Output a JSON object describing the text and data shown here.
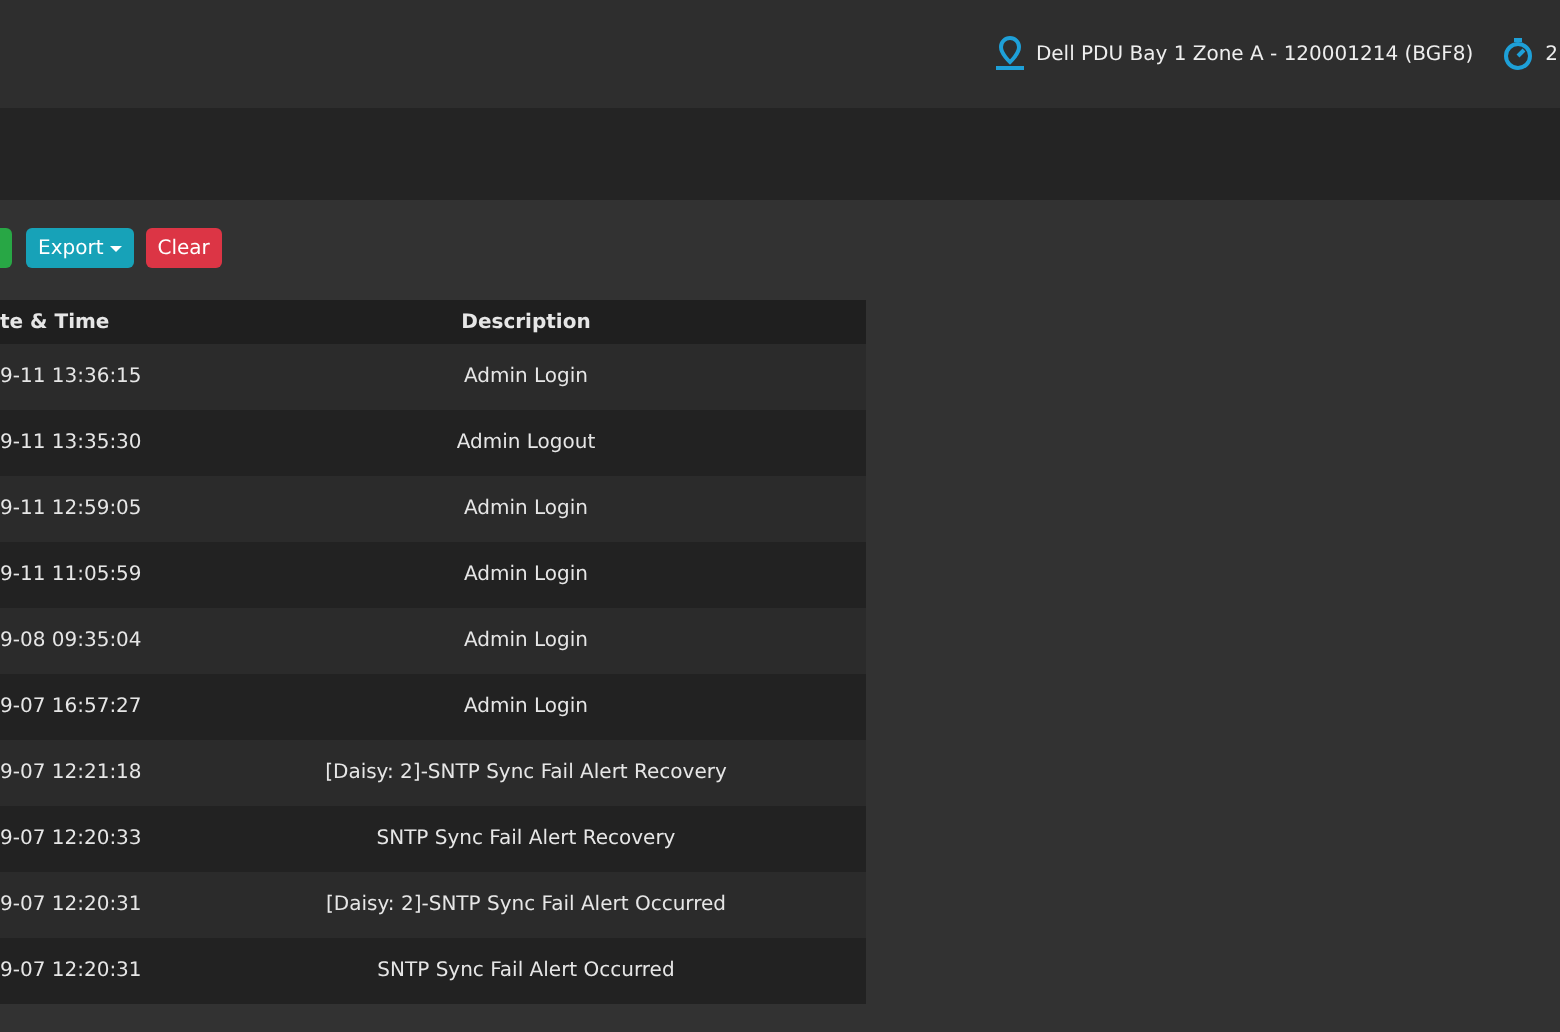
{
  "top_bar": {
    "device": "Dell PDU Bay 1 Zone A - 120001214 (BGF8)",
    "clock_text": "2"
  },
  "toolbar": {
    "buttons": [
      {
        "kind": "green"
      },
      {
        "kind": "export",
        "label": "Export"
      },
      {
        "kind": "clear",
        "label": "Clear"
      }
    ]
  },
  "table": {
    "columns": [
      "te & Time",
      "Description"
    ],
    "rows": [
      {
        "time": "9-11 13:36:15",
        "description": "Admin Login"
      },
      {
        "time": "9-11 13:35:30",
        "description": "Admin Logout"
      },
      {
        "time": "9-11 12:59:05",
        "description": "Admin Login"
      },
      {
        "time": "9-11 11:05:59",
        "description": "Admin Login"
      },
      {
        "time": "9-08 09:35:04",
        "description": "Admin Login"
      },
      {
        "time": "9-07 16:57:27",
        "description": "Admin Login"
      },
      {
        "time": "9-07 12:21:18",
        "description": "[Daisy: 2]-SNTP Sync Fail Alert Recovery"
      },
      {
        "time": "9-07 12:20:33",
        "description": "SNTP Sync Fail Alert Recovery"
      },
      {
        "time": "9-07 12:20:31",
        "description": "[Daisy: 2]-SNTP Sync Fail Alert Occurred"
      },
      {
        "time": "9-07 12:20:31",
        "description": "SNTP Sync Fail Alert Occurred"
      }
    ]
  }
}
